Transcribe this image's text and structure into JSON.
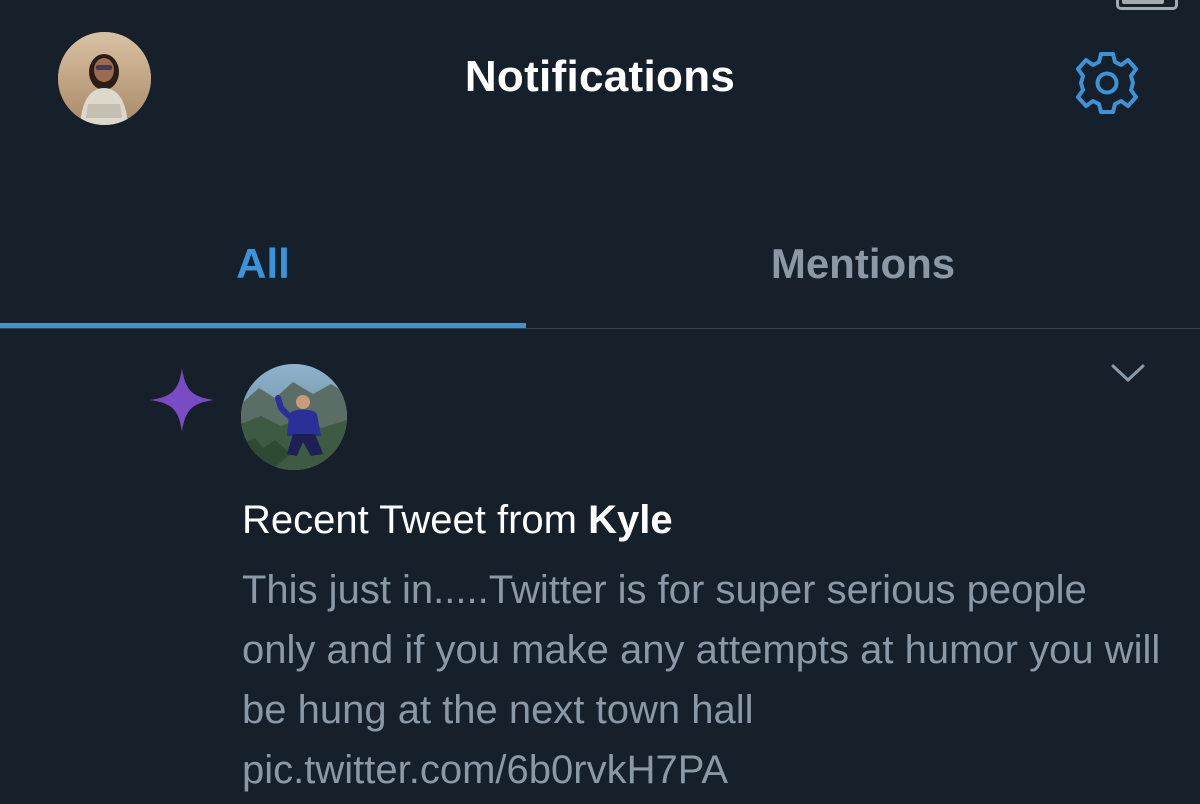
{
  "header": {
    "title": "Notifications",
    "profile_icon": "user-avatar",
    "settings_icon": "gear-icon"
  },
  "tabs": [
    {
      "label": "All",
      "active": true
    },
    {
      "label": "Mentions",
      "active": false
    }
  ],
  "notification": {
    "type_icon": "sparkle-icon",
    "title_prefix": "Recent Tweet from ",
    "title_name": "Kyle",
    "body": "This just in.....Twitter is for super serious people only and if you make any attempts at humor you will be hung at the next town hall pic.twitter.com/6b0rvkH7PA",
    "menu_icon": "chevron-down-icon"
  },
  "colors": {
    "background": "#15202b",
    "accent": "#3b94d9",
    "muted_text": "#8b98a5",
    "sparkle": "#794bc4",
    "divider": "#38444d"
  }
}
